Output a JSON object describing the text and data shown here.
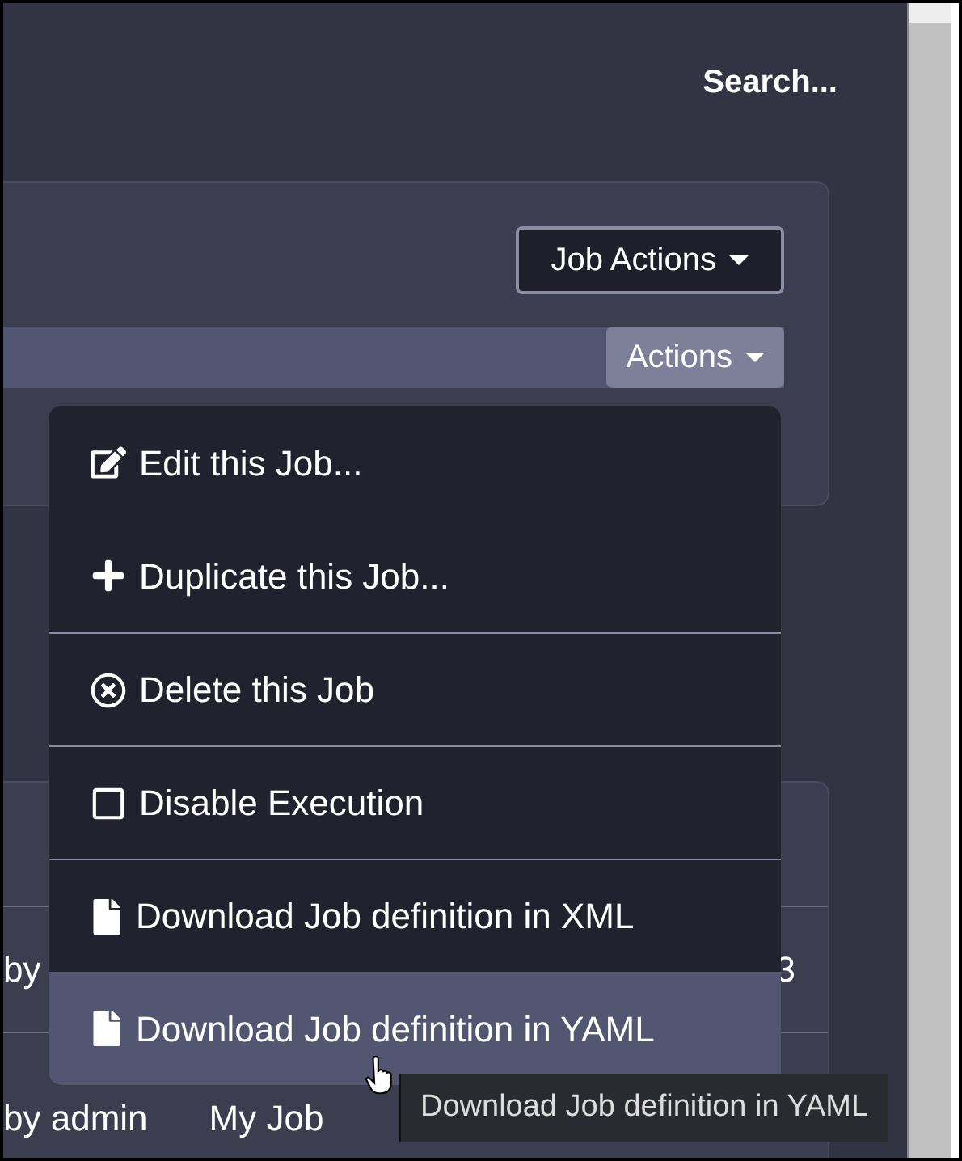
{
  "search_label": "Search...",
  "job_actions_button": "Job Actions",
  "actions_button": "Actions",
  "menu": {
    "items": [
      {
        "kind": "edit",
        "label": "Edit this Job...",
        "divider_before": false,
        "selected": false
      },
      {
        "kind": "plus",
        "label": "Duplicate this Job...",
        "divider_before": false,
        "selected": false
      },
      {
        "kind": "delete",
        "label": "Delete this Job",
        "divider_before": true,
        "selected": false
      },
      {
        "kind": "disable",
        "label": "Disable Execution",
        "divider_before": true,
        "selected": false
      },
      {
        "kind": "file",
        "label": "Download Job definition in XML",
        "divider_before": true,
        "selected": false
      },
      {
        "kind": "file",
        "label": "Download Job definition in YAML",
        "divider_before": false,
        "selected": true
      }
    ]
  },
  "rows": [
    {
      "cells": [
        "by",
        "3"
      ]
    },
    {
      "cells": [
        "by admin",
        "My Job"
      ]
    }
  ],
  "tooltip": "Download Job definition in YAML"
}
